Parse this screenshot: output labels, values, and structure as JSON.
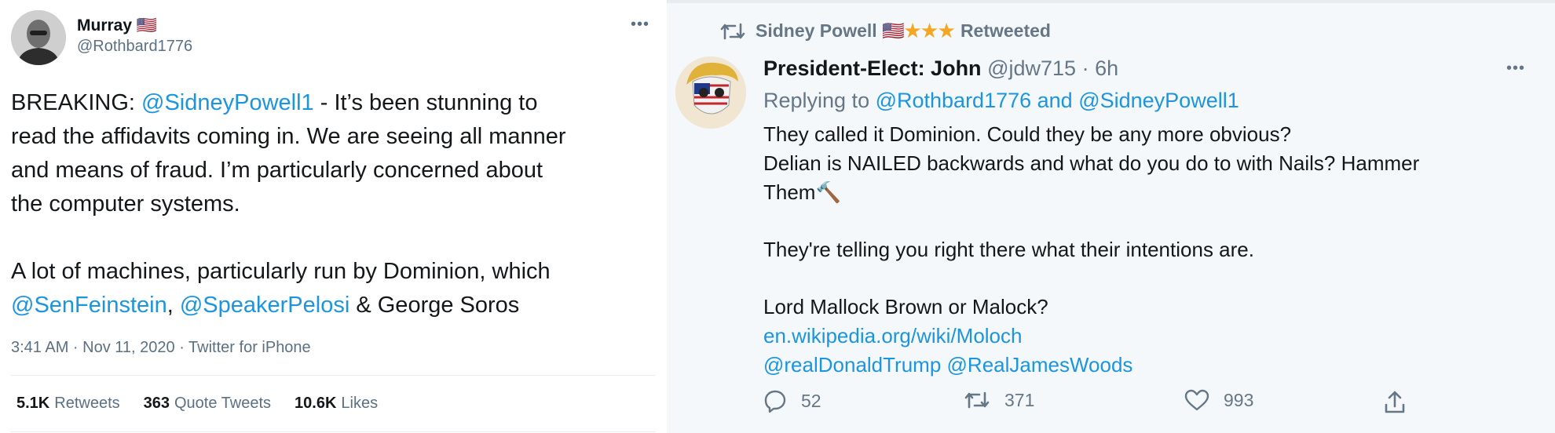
{
  "left_tweet": {
    "author_name": "Murray",
    "author_flag": "🇺🇸",
    "handle": "@Rothbard1776",
    "more": "•••",
    "body": {
      "p1_prefix": "BREAKING: ",
      "p1_mention": "@SidneyPowell1",
      "p1_line1_rest": " - It’s been stunning to",
      "p1_line2": "read the affidavits coming in. We are seeing all manner",
      "p1_line3": "and means of fraud. I’m particularly concerned about",
      "p1_line4": "the computer systems.",
      "p2_line1": "A lot of machines, particularly run by Dominion, which",
      "p2_mention1": "@SenFeinstein",
      "p2_sep": ", ",
      "p2_mention2": "@SpeakerPelosi",
      "p2_tail": " & George Soros"
    },
    "meta": "3:41 AM · Nov 11, 2020 · Twitter for iPhone",
    "stats": {
      "retweets_count": "5.1K",
      "retweets_label": "Retweets",
      "quotes_count": "363",
      "quotes_label": "Quote Tweets",
      "likes_count": "10.6K",
      "likes_label": "Likes"
    }
  },
  "right_tweet": {
    "retweeted_by": "Sidney Powell",
    "retweeted_by_decor": "🇺🇸",
    "stars": "★★★",
    "retweeted_label": "Retweeted",
    "author_name": "President-Elect: John",
    "handle": "@jdw715",
    "time": "· 6h",
    "more": "•••",
    "reply_prefix": "Replying to ",
    "reply_mention1": "@Rothbard1776",
    "reply_and": " and ",
    "reply_mention2": "@SidneyPowell1",
    "body": {
      "line1": "They called it Dominion. Could they be any more obvious?",
      "line2": "Delian is NAILED backwards and what do you do to with Nails? Hammer",
      "line3": "Them🔨",
      "line4": "They're telling you right there what their intentions are.",
      "line5": "Lord Mallock Brown or Malock?",
      "link": "en.wikipedia.org/wiki/Moloch",
      "mention1": "@realDonaldTrump",
      "mention2": "@RealJamesWoods"
    },
    "actions": {
      "replies": "52",
      "retweets": "371",
      "likes": "993"
    }
  },
  "icons": [
    "avatar-left",
    "avatar-right",
    "retweet-icon",
    "reply-icon",
    "like-icon",
    "share-icon",
    "more-icon"
  ],
  "colors": {
    "link": "#1b95e0",
    "muted": "#657786",
    "star": "#f5a623",
    "right_bg": "#f5f8fa"
  }
}
